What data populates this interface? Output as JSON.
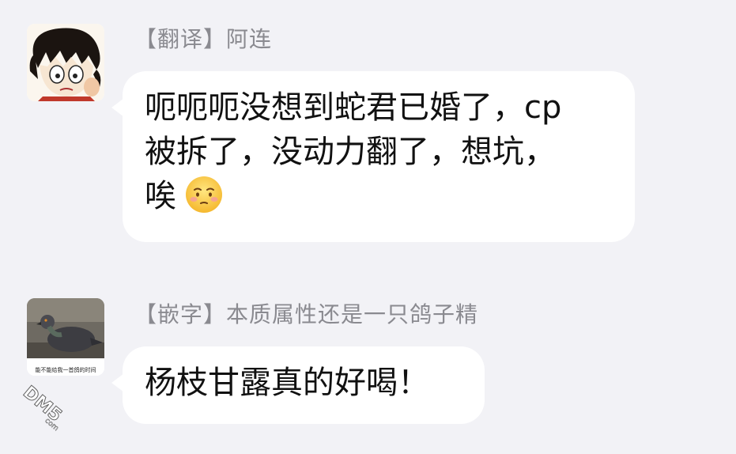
{
  "messages": [
    {
      "sender": "【翻译】阿连",
      "lines": [
        "呃呃呃没想到蛇君已婚了，cp",
        "被拆了，没动力翻了，想坑，",
        "唉"
      ],
      "emoji": "blushing-face-icon"
    },
    {
      "sender": "【嵌字】本质属性还是一只鸽子精",
      "lines": [
        "杨枝甘露真的好喝！"
      ],
      "avatar_caption": "能不能给我一首鸽的时间"
    }
  ],
  "watermark": {
    "text": "DM5",
    "suffix": "com"
  },
  "colors": {
    "background": "#f2f2f6",
    "bubble": "#ffffff",
    "sender_text": "#8a8a90"
  }
}
